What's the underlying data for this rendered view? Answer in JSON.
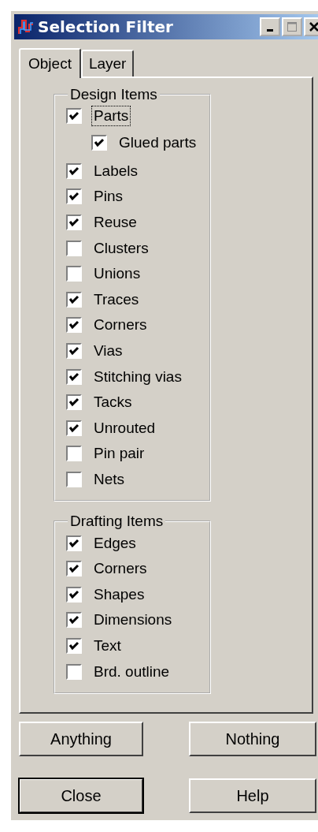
{
  "window": {
    "title": "Selection Filter"
  },
  "tabs": [
    {
      "label": "Object",
      "selected": true
    },
    {
      "label": "Layer",
      "selected": false
    }
  ],
  "groups": [
    {
      "title": "Design Items",
      "items": [
        {
          "label": "Parts",
          "checked": true,
          "focused": true,
          "children": [
            {
              "label": "Glued parts",
              "checked": true,
              "focused": false
            }
          ]
        },
        {
          "label": "Labels",
          "checked": true,
          "focused": false
        },
        {
          "label": "Pins",
          "checked": true,
          "focused": false
        },
        {
          "label": "Reuse",
          "checked": true,
          "focused": false
        },
        {
          "label": "Clusters",
          "checked": false,
          "focused": false
        },
        {
          "label": "Unions",
          "checked": false,
          "focused": false
        },
        {
          "label": "Traces",
          "checked": true,
          "focused": false
        },
        {
          "label": "Corners",
          "checked": true,
          "focused": false
        },
        {
          "label": "Vias",
          "checked": true,
          "focused": false
        },
        {
          "label": "Stitching vias",
          "checked": true,
          "focused": false
        },
        {
          "label": "Tacks",
          "checked": true,
          "focused": false
        },
        {
          "label": "Unrouted",
          "checked": true,
          "focused": false
        },
        {
          "label": "Pin pair",
          "checked": false,
          "focused": false
        },
        {
          "label": "Nets",
          "checked": false,
          "focused": false
        }
      ]
    },
    {
      "title": "Drafting Items",
      "items": [
        {
          "label": "Edges",
          "checked": true,
          "focused": false
        },
        {
          "label": "Corners",
          "checked": true,
          "focused": false
        },
        {
          "label": "Shapes",
          "checked": true,
          "focused": false
        },
        {
          "label": "Dimensions",
          "checked": true,
          "focused": false
        },
        {
          "label": "Text",
          "checked": true,
          "focused": false
        },
        {
          "label": "Brd. outline",
          "checked": false,
          "focused": false
        }
      ]
    }
  ],
  "buttons": [
    {
      "label": "Anything",
      "default": false
    },
    {
      "label": "Nothing",
      "default": false
    },
    {
      "label": "Close",
      "default": true
    },
    {
      "label": "Help",
      "default": false
    }
  ]
}
